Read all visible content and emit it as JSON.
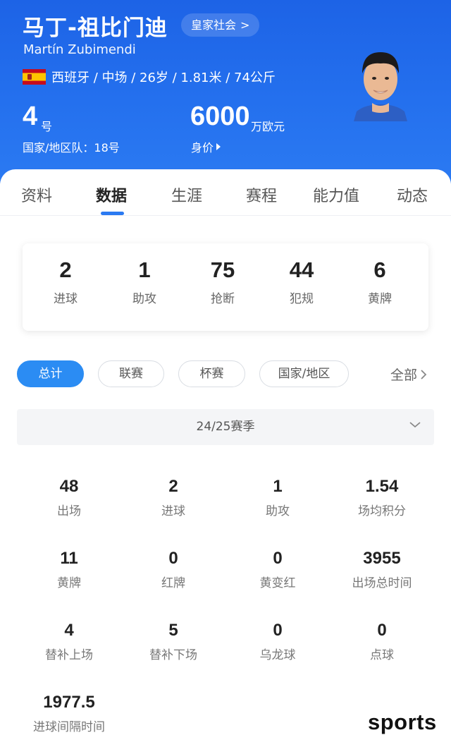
{
  "player": {
    "name_cn": "马丁-祖比门迪",
    "name_en": "Martín Zubimendi",
    "club_label": "皇家社会",
    "info": "西班牙 / 中场 / 26岁 / 1.81米 / 74公斤",
    "shirt_number": "4",
    "shirt_unit": "号",
    "national_team": "国家/地区队：18号",
    "market_value": "6000",
    "market_value_unit": "万欧元",
    "market_value_label": "身价"
  },
  "tabs": [
    {
      "label": "资料"
    },
    {
      "label": "数据",
      "active": true
    },
    {
      "label": "生涯"
    },
    {
      "label": "赛程"
    },
    {
      "label": "能力值"
    },
    {
      "label": "动态"
    }
  ],
  "summary": [
    {
      "value": "2",
      "label": "进球"
    },
    {
      "value": "1",
      "label": "助攻"
    },
    {
      "value": "75",
      "label": "抢断"
    },
    {
      "value": "44",
      "label": "犯规"
    },
    {
      "value": "6",
      "label": "黄牌"
    }
  ],
  "filters": {
    "chips": [
      {
        "label": "总计",
        "active": true
      },
      {
        "label": "联赛"
      },
      {
        "label": "杯赛"
      },
      {
        "label": "国家/地区"
      }
    ],
    "all_label": "全部"
  },
  "season": {
    "selected": "24/25赛季"
  },
  "stats": [
    {
      "value": "48",
      "label": "出场"
    },
    {
      "value": "2",
      "label": "进球"
    },
    {
      "value": "1",
      "label": "助攻"
    },
    {
      "value": "1.54",
      "label": "场均积分"
    },
    {
      "value": "11",
      "label": "黄牌"
    },
    {
      "value": "0",
      "label": "红牌"
    },
    {
      "value": "0",
      "label": "黄变红"
    },
    {
      "value": "3955",
      "label": "出场总时间"
    },
    {
      "value": "4",
      "label": "替补上场"
    },
    {
      "value": "5",
      "label": "替补下场"
    },
    {
      "value": "0",
      "label": "乌龙球"
    },
    {
      "value": "0",
      "label": "点球"
    },
    {
      "value": "1977.5",
      "label": "进球间隔时间"
    }
  ],
  "watermark": "sports",
  "colors": {
    "brand_blue": "#2470ee",
    "chip_active": "#2b8cf3",
    "tab_indicator": "#2b7af2"
  }
}
